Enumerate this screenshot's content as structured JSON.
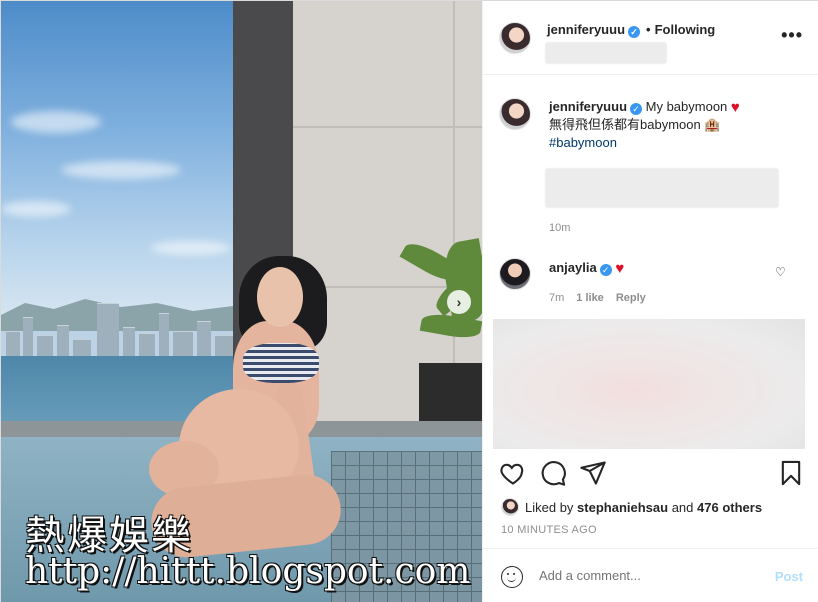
{
  "post": {
    "author": "jenniferyuuu",
    "follow_status": "Following",
    "more_options_label": "•••",
    "verified_mark": "✓"
  },
  "caption": {
    "username": "jenniferyuuu",
    "line1": "My babymoon",
    "line2": "無得飛但係都有babymoon 🏨",
    "hashtag": "#babymoon",
    "age": "10m"
  },
  "comment": {
    "username": "anjaylia",
    "age": "7m",
    "likes": "1 like",
    "reply_label": "Reply"
  },
  "likes": {
    "prefix": "Liked by",
    "user": "stephaniehsau",
    "conjunction": "and",
    "others": "476 others"
  },
  "posted": "10 MINUTES AGO",
  "composer": {
    "placeholder": "Add a comment...",
    "post_label": "Post"
  },
  "watermark": {
    "line1": "熱爆娛樂",
    "line2": "http://hittt.blogspot.com"
  },
  "icons": {
    "heart": "heart-icon",
    "comment": "comment-icon",
    "share": "share-icon",
    "save": "bookmark-icon",
    "next": "chevron-right-icon",
    "emoji": "emoji-icon"
  },
  "colors": {
    "verified_blue": "#3897f0",
    "red_heart": "#e0102b",
    "hashtag_blue": "#00376b",
    "meta_grey": "#8e8e8e",
    "post_button_disabled": "#b2dffc"
  }
}
